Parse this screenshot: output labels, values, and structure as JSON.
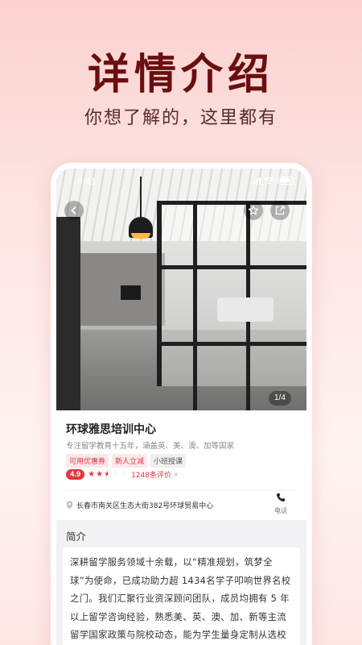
{
  "hero": {
    "title": "详情介绍",
    "subtitle": "你想了解的，这里都有"
  },
  "status_bar": {
    "time": "9:41"
  },
  "gallery": {
    "counter": "1/4"
  },
  "listing": {
    "name": "环球雅思培训中心",
    "description": "专注留学教育十五年，涵盖英、美、澳、加等国家",
    "tags": [
      "可用优惠券",
      "新人立减",
      "小班授课"
    ],
    "rating_score": "4.9",
    "rating_stars": 2.5,
    "reviews": "1248条评价",
    "address": "长春市南关区生态大街382号环球贸易中心",
    "phone_label": "电话"
  },
  "intro": {
    "heading": "简介",
    "text": "深耕留学服务领域十余载，以“精准规划，筑梦全球”为使命，已成功助力超 1434名学子叩响世界名校之门。我们汇聚行业资深顾问团队，成员均拥有 5 年以上留学咨询经验，熟悉美、英、澳、加、新等主流留学国家政策与院校动态，能为学生量身定制从选校定位、文书润色到面试辅导、签证办理的全链条解决方案。"
  },
  "colors": {
    "accent": "#e8343e",
    "hero": "#6a0e10"
  },
  "icons": [
    "back-icon",
    "star-icon",
    "share-icon",
    "location-pin-icon",
    "phone-icon"
  ]
}
